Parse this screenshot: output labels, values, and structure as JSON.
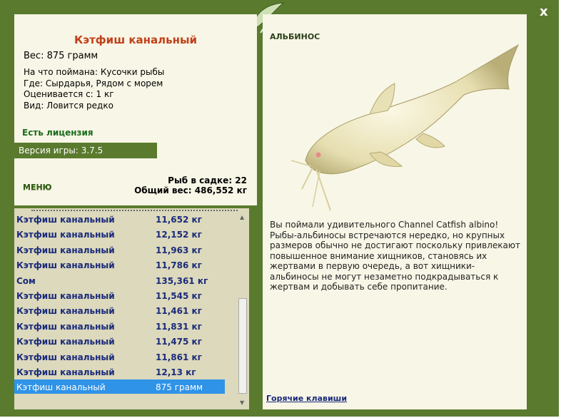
{
  "header": {
    "close_label": "x"
  },
  "fish": {
    "name": "Кэтфиш канальный",
    "weight_line": "Вес: 875 грамм",
    "caught_with": "На что поймана: Кусочки рыбы",
    "location": "Где: Сырдарья, Рядом с морем",
    "valued": "Оценивается с: 1 кг",
    "rarity": "Вид: Ловится редко"
  },
  "license_label": "Есть лицензия",
  "version_label": "Версия игры: 3.7.5",
  "menu_label": "МЕНЮ",
  "stats": {
    "fish_in_cage": "Рыб в садке: 22",
    "total_weight": "Общий вес: 486,552 кг"
  },
  "catch_list": [
    {
      "name": "Кэтфиш канальный",
      "weight": "11,652 кг"
    },
    {
      "name": "Кэтфиш канальный",
      "weight": "12,152 кг"
    },
    {
      "name": "Кэтфиш канальный",
      "weight": "11,963 кг"
    },
    {
      "name": "Кэтфиш канальный",
      "weight": "11,786 кг"
    },
    {
      "name": "Сом",
      "weight": "135,361 кг"
    },
    {
      "name": "Кэтфиш канальный",
      "weight": "11,545 кг"
    },
    {
      "name": "Кэтфиш канальный",
      "weight": "11,461 кг"
    },
    {
      "name": "Кэтфиш канальный",
      "weight": "11,831 кг"
    },
    {
      "name": "Кэтфиш канальный",
      "weight": "11,475 кг"
    },
    {
      "name": "Кэтфиш канальный",
      "weight": "11,861 кг"
    },
    {
      "name": "Кэтфиш канальный",
      "weight": "12,13 кг"
    },
    {
      "name": "Кэтфиш канальный",
      "weight": "875 грамм"
    }
  ],
  "albino": {
    "label": "АЛЬБИНОС",
    "description": "Вы поймали удивительного Channel Catfish albino! Рыбы-альбиносы встречаются нередко, но крупных размеров обычно не достигают поскольку привлекают повышенное внимание хищников, становясь их жертвами в первую очередь, а вот хищники-альбиносы не могут незаметно подкрадываться к жертвам и добывать себе пропитание."
  },
  "hotkeys_label": "Горячие клавиши",
  "colors": {
    "frame": "#5a7a2e",
    "panel": "#f8f6e6",
    "selection": "#2f93e8",
    "title": "#c0401a"
  }
}
